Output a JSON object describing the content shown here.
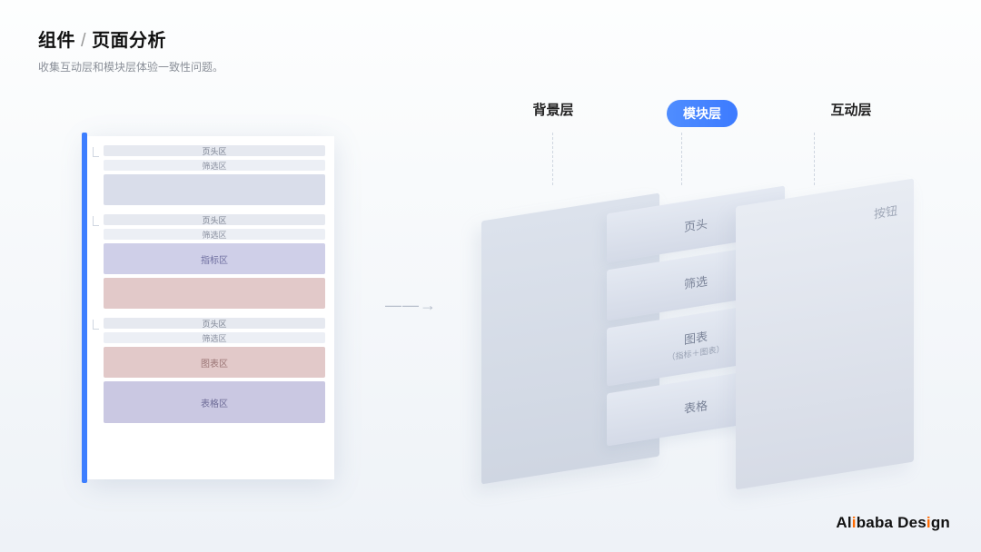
{
  "header": {
    "prefix": "组件",
    "sep": "/",
    "title": "页面分析",
    "subtitle": "收集互动层和模块层体验一致性问题。"
  },
  "wire": {
    "g1": {
      "head": "页头区",
      "filter": "筛选区"
    },
    "g2": {
      "head": "页头区",
      "filter": "筛选区",
      "indicator": "指标区"
    },
    "g3": {
      "head": "页头区",
      "filter": "筛选区",
      "chart": "图表区",
      "table": "表格区"
    }
  },
  "arrow": "— — →",
  "layers": {
    "bg": "背景层",
    "mod": "模块层",
    "int": "互动层",
    "mod_items": {
      "a": "页头",
      "b": "筛选",
      "c": "图表",
      "c_sub": "（指标＋图表）",
      "d": "表格"
    },
    "int_item": "按钮"
  },
  "brand": {
    "a": "Al",
    "i": "i",
    "b": "baba Des",
    "i2": "i",
    "c": "gn"
  }
}
